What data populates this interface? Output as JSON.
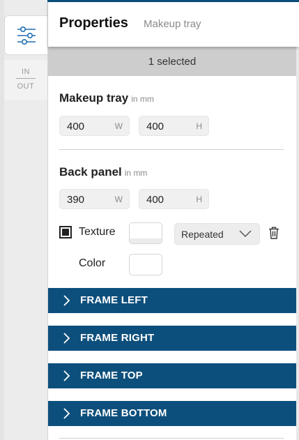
{
  "header": {
    "title": "Properties",
    "subtitle": "Makeup tray"
  },
  "rail": {
    "in_label": "IN",
    "out_label": "OUT",
    "properties_icon": "sliders-icon"
  },
  "selection": {
    "text": "1 selected"
  },
  "makeup_tray": {
    "title": "Makeup tray",
    "unit": "in mm",
    "width": {
      "value": "400",
      "suffix": "W"
    },
    "height": {
      "value": "400",
      "suffix": "H"
    }
  },
  "back_panel": {
    "title": "Back panel",
    "unit": "in mm",
    "width": {
      "value": "390",
      "suffix": "W"
    },
    "height": {
      "value": "400",
      "suffix": "H"
    },
    "texture_label": "Texture",
    "texture_checked": true,
    "texture_mode": "Repeated",
    "color_label": "Color"
  },
  "accordions": [
    {
      "label": "FRAME LEFT"
    },
    {
      "label": "FRAME RIGHT"
    },
    {
      "label": "FRAME TOP"
    },
    {
      "label": "FRAME BOTTOM"
    }
  ],
  "colors": {
    "accent": "#0d4f7c",
    "selected_bar": "#cdcdcd",
    "field_bg": "#f0f0f0"
  }
}
